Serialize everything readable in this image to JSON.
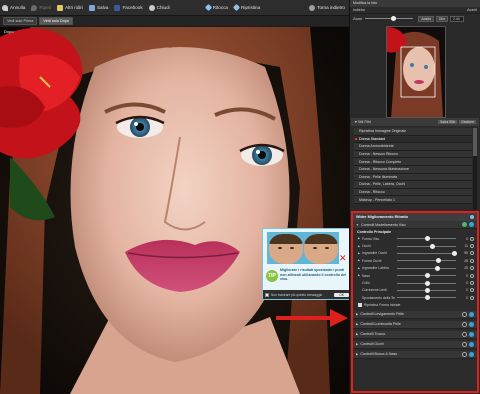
{
  "toolbar": {
    "undo": "Annulla",
    "redo": "Ripeti",
    "open": "Altri ridiri",
    "save": "Salva",
    "facebook": "Facebook",
    "close": "Chiudi",
    "retouch": "Ritocca",
    "restore": "Ripristina",
    "back": "Torna indietro"
  },
  "view_tabs": [
    "Vedi solo Prima",
    "Vedi solo Dopo"
  ],
  "photo": {
    "label": "Dopo"
  },
  "tip": {
    "badge": "TIP",
    "text": "Migliorare i risultati spostando i punti non allineati utilizzando il controllo del viso.",
    "dont_show": "Non mostrare più questo messaggio",
    "ok": "OK"
  },
  "panel": {
    "title": "Modifica la foto",
    "navigator": "Indietro",
    "navigator_right": "Avanti",
    "zoom_label": "Zoom",
    "zoom_fit": "Adatta",
    "zoom_actual": "Dim",
    "zoom_value": "2.44"
  },
  "filters": {
    "header": "Stili Filtri",
    "save_btn": "Salva Stile",
    "manage_btn": "Gestione",
    "presets": [
      "Ripristina Immagine Originale",
      "Donna Standard",
      "Donna Ammorbidente",
      "Donna - Nessun Ritocco",
      "Donna - Ritocco Completo",
      "Donna - Nessuna Illuminazione",
      "Donna - Pelle Illuminata",
      "Donna - Pelle, Labbra, Occhi",
      "Donna - Ritocco",
      "Makeup - Pennellato 1"
    ],
    "selected": 1
  },
  "workflow": {
    "title": "Wider Miglioramento Ritratto",
    "face_section": "Controlli Modellamento Viso",
    "subheader": "Controllo Principale",
    "controls": [
      {
        "label": "Forma Viso",
        "value": "0",
        "pos": 0.5
      },
      {
        "label": "Occhi",
        "value": "11",
        "pos": 0.6
      },
      {
        "label": "Ingrandire Occhi",
        "value": "99",
        "pos": 1.0
      },
      {
        "label": "Forma Occhi",
        "value": "28",
        "pos": 0.7
      },
      {
        "label": "Ingrandire Labbra",
        "value": "25",
        "pos": 0.68
      },
      {
        "label": "Naso",
        "value": "0",
        "pos": 0.5
      },
      {
        "label": "Collo",
        "value": "0",
        "pos": 0.5
      },
      {
        "label": "Correzione Lenti",
        "value": "0",
        "pos": 0.5
      },
      {
        "label": "Spostamento della Testa",
        "value": "0",
        "pos": 0.5
      }
    ],
    "checkbox": "Ripristina Forma Iniziale",
    "sections": [
      "Controlli Levigamento Pelle",
      "Controlli Luminosità Pelle",
      "Controlli Trucco",
      "Controlli Occhi",
      "Controlli Bocca & Naso"
    ]
  }
}
